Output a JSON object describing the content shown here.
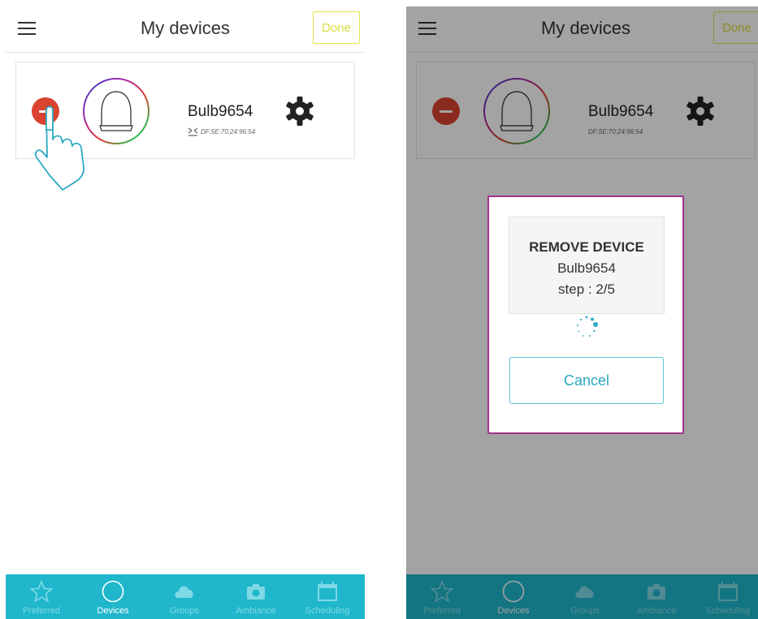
{
  "screens": [
    {
      "header": {
        "title": "My devices",
        "done_label": "Done"
      },
      "device": {
        "name": "Bulb9654",
        "mac": "DF:5E:70:24:96:54"
      },
      "nav": [
        {
          "label": "Preferred",
          "icon": "star-icon"
        },
        {
          "label": "Devices",
          "icon": "circle-icon",
          "active": true
        },
        {
          "label": "Groups",
          "icon": "cloud-icon"
        },
        {
          "label": "Ambiance",
          "icon": "camera-icon"
        },
        {
          "label": "Scheduling",
          "icon": "calendar-icon"
        }
      ]
    },
    {
      "header": {
        "title": "My devices",
        "done_label": "Done"
      },
      "device": {
        "name": "Bulb9654",
        "mac": "DF:5E:70:24:96:54"
      },
      "dialog": {
        "title": "REMOVE DEVICE",
        "device": "Bulb9654",
        "step": "step : 2/5",
        "cancel_label": "Cancel"
      },
      "nav": [
        {
          "label": "Preferred",
          "icon": "star-icon"
        },
        {
          "label": "Devices",
          "icon": "circle-icon",
          "active": true
        },
        {
          "label": "Groups",
          "icon": "cloud-icon"
        },
        {
          "label": "Ambiance",
          "icon": "camera-icon"
        },
        {
          "label": "Scheduling",
          "icon": "calendar-icon"
        }
      ]
    }
  ],
  "colors": {
    "done_border": "#e2e44a",
    "remove_button": "#d9432f",
    "nav_background": "#20b7cc",
    "dialog_border": "#a1348b",
    "cancel_border": "#5bc7d8"
  }
}
